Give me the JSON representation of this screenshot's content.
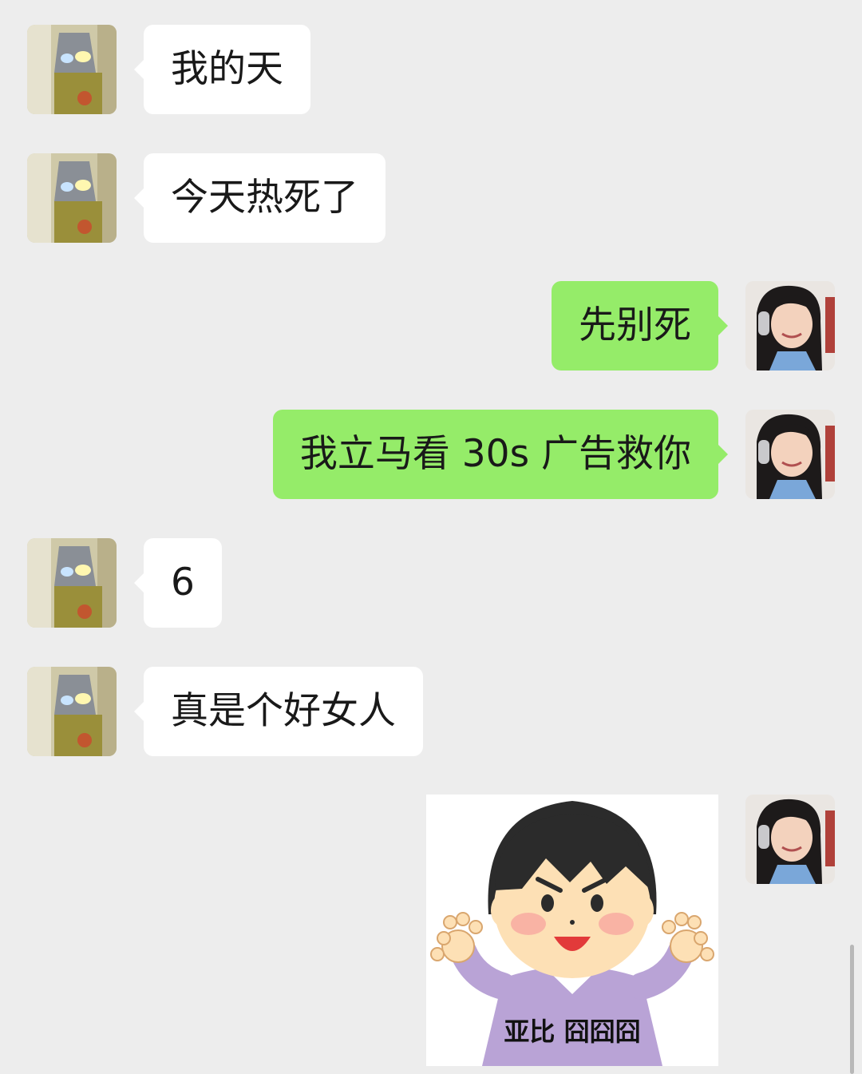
{
  "messages": [
    {
      "side": "in",
      "type": "text",
      "text": "我的天"
    },
    {
      "side": "in",
      "type": "text",
      "text": "今天热死了"
    },
    {
      "side": "out",
      "type": "text",
      "text": "先别死"
    },
    {
      "side": "out",
      "type": "text",
      "text": "我立马看 30s 广告救你"
    },
    {
      "side": "in",
      "type": "text",
      "text": "6"
    },
    {
      "side": "in",
      "type": "text",
      "text": "真是个好女人"
    },
    {
      "side": "out",
      "type": "sticker",
      "caption": "亚比 囧囧囧"
    }
  ],
  "avatars": {
    "contact": "contact-avatar (masked figure photo)",
    "self": "self-avatar (girl with headphones photo)"
  },
  "colors": {
    "background": "#ededed",
    "incoming_bubble": "#ffffff",
    "outgoing_bubble": "#95ec69",
    "text": "#191919"
  }
}
